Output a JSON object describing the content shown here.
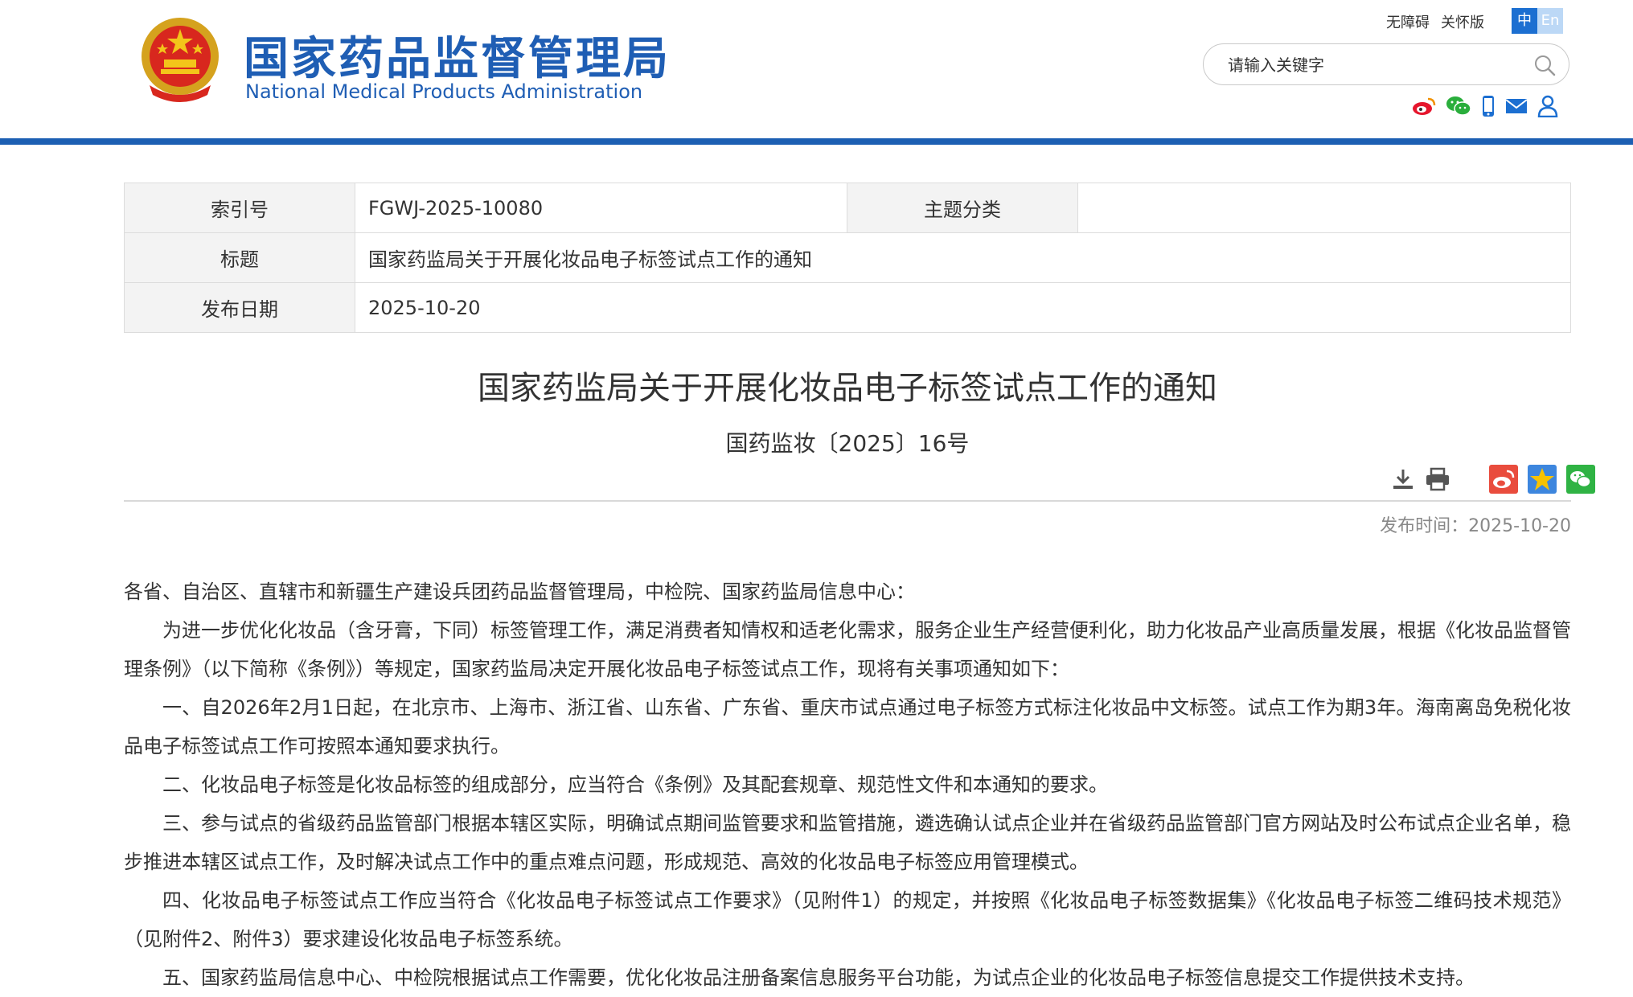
{
  "header": {
    "title_cn": "国家药品监督管理局",
    "title_en": "National Medical Products Administration",
    "links": [
      "无障碍",
      "关怀版"
    ],
    "lang": {
      "zh": "中",
      "en": "En"
    },
    "search": {
      "placeholder": "请输入关键字"
    },
    "accent_color": "#1c5fb3"
  },
  "info": {
    "index_label": "索引号",
    "index_value": "FGWJ-2025-10080",
    "category_label": "主题分类",
    "category_value": "",
    "title_label": "标题",
    "title_value": "国家药监局关于开展化妆品电子标签试点工作的通知",
    "date_label": "发布日期",
    "date_value": "2025-10-20"
  },
  "article": {
    "title": "国家药监局关于开展化妆品电子标签试点工作的通知",
    "doc_number": "国药监妆〔2025〕16号",
    "publish_time": "发布时间：2025-10-20",
    "paragraphs": [
      "各省、自治区、直辖市和新疆生产建设兵团药品监督管理局，中检院、国家药监局信息中心：",
      "为进一步优化化妆品（含牙膏，下同）标签管理工作，满足消费者知情权和适老化需求，服务企业生产经营便利化，助力化妆品产业高质量发展，根据《化妆品监督管理条例》（以下简称《条例》）等规定，国家药监局决定开展化妆品电子标签试点工作，现将有关事项通知如下：",
      "一、自2026年2月1日起，在北京市、上海市、浙江省、山东省、广东省、重庆市试点通过电子标签方式标注化妆品中文标签。试点工作为期3年。海南离岛免税化妆品电子标签试点工作可按照本通知要求执行。",
      "二、化妆品电子标签是化妆品标签的组成部分，应当符合《条例》及其配套规章、规范性文件和本通知的要求。",
      "三、参与试点的省级药品监管部门根据本辖区实际，明确试点期间监管要求和监管措施，遴选确认试点企业并在省级药品监管部门官方网站及时公布试点企业名单，稳步推进本辖区试点工作，及时解决试点工作中的重点难点问题，形成规范、高效的化妆品电子标签应用管理模式。",
      "四、化妆品电子标签试点工作应当符合《化妆品电子标签试点工作要求》（见附件1）的规定，并按照《化妆品电子标签数据集》《化妆品电子标签二维码技术规范》（见附件2、附件3）要求建设化妆品电子标签系统。",
      "五、国家药监局信息中心、中检院根据试点工作需要，优化化妆品注册备案信息服务平台功能，为试点企业的化妆品电子标签信息提交工作提供技术支持。"
    ]
  }
}
